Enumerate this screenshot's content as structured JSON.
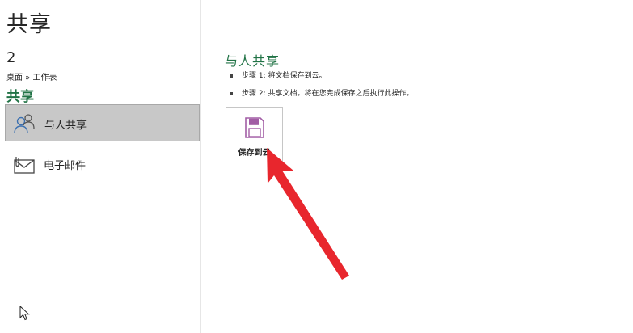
{
  "page": {
    "title": "共享"
  },
  "file": {
    "name": "2",
    "breadcrumb": "桌面 » 工作表"
  },
  "sidebar": {
    "section_title": "共享",
    "items": [
      {
        "label": "与人共享",
        "icon": "people-share-icon",
        "selected": true
      },
      {
        "label": "电子邮件",
        "icon": "email-icon",
        "selected": false
      }
    ]
  },
  "main": {
    "heading": "与人共享",
    "steps": [
      "步骤 1:  将文档保存到云。",
      "步骤 2: 共享文档。将在您完成保存之后执行此操作。"
    ],
    "save_button": {
      "label": "保存到云",
      "icon": "save-floppy-icon"
    }
  },
  "colors": {
    "accent_green": "#217346",
    "selected_bg": "#c8c8c8",
    "annotation_red": "#e8262d",
    "floppy_purple": "#a25da5"
  }
}
